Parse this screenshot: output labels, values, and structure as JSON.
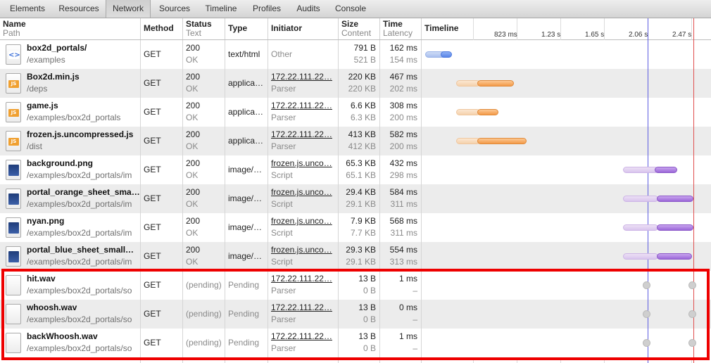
{
  "tabs": [
    "Elements",
    "Resources",
    "Network",
    "Sources",
    "Timeline",
    "Profiles",
    "Audits",
    "Console"
  ],
  "active_tab": "Network",
  "columns": {
    "name": {
      "title": "Name",
      "sub": "Path"
    },
    "method": {
      "title": "Method"
    },
    "status": {
      "title": "Status",
      "sub": "Text"
    },
    "type": {
      "title": "Type"
    },
    "initiator": {
      "title": "Initiator"
    },
    "size": {
      "title": "Size",
      "sub": "Content"
    },
    "time": {
      "title": "Time",
      "sub": "Latency"
    },
    "timeline": {
      "title": "Timeline"
    }
  },
  "timeline_ticks": [
    "823 ms",
    "1.23 s",
    "1.65 s",
    "2.06 s",
    "2.47 s"
  ],
  "highlight_color": "#ee0000",
  "rows": [
    {
      "name": "box2d_portals/",
      "path": "/examples",
      "method": "GET",
      "status": "200",
      "status_text": "OK",
      "type": "text/html",
      "initiator": "Other",
      "initiator_sub": "",
      "initiator_link": false,
      "size": "791 B",
      "content": "521 B",
      "time": "162 ms",
      "latency": "154 ms",
      "icon": "html-icon"
    },
    {
      "name": "Box2d.min.js",
      "path": "/deps",
      "method": "GET",
      "status": "200",
      "status_text": "OK",
      "type": "applica…",
      "initiator": "172.22.111.22…",
      "initiator_sub": "Parser",
      "initiator_link": true,
      "size": "220 KB",
      "content": "220 KB",
      "time": "467 ms",
      "latency": "202 ms",
      "icon": "js-icon"
    },
    {
      "name": "game.js",
      "path": "/examples/box2d_portals",
      "method": "GET",
      "status": "200",
      "status_text": "OK",
      "type": "applica…",
      "initiator": "172.22.111.22…",
      "initiator_sub": "Parser",
      "initiator_link": true,
      "size": "6.6 KB",
      "content": "6.3 KB",
      "time": "308 ms",
      "latency": "200 ms",
      "icon": "js-icon"
    },
    {
      "name": "frozen.js.uncompressed.js",
      "path": "/dist",
      "method": "GET",
      "status": "200",
      "status_text": "OK",
      "type": "applica…",
      "initiator": "172.22.111.22…",
      "initiator_sub": "Parser",
      "initiator_link": true,
      "size": "413 KB",
      "content": "412 KB",
      "time": "582 ms",
      "latency": "200 ms",
      "icon": "js-icon"
    },
    {
      "name": "background.png",
      "path": "/examples/box2d_portals/im",
      "method": "GET",
      "status": "200",
      "status_text": "OK",
      "type": "image/…",
      "initiator": "frozen.js.unco…",
      "initiator_sub": "Script",
      "initiator_link": true,
      "size": "65.3 KB",
      "content": "65.1 KB",
      "time": "432 ms",
      "latency": "298 ms",
      "icon": "image-icon"
    },
    {
      "name": "portal_orange_sheet_sma…",
      "path": "/examples/box2d_portals/im",
      "method": "GET",
      "status": "200",
      "status_text": "OK",
      "type": "image/…",
      "initiator": "frozen.js.unco…",
      "initiator_sub": "Script",
      "initiator_link": true,
      "size": "29.4 KB",
      "content": "29.1 KB",
      "time": "584 ms",
      "latency": "311 ms",
      "icon": "image-icon"
    },
    {
      "name": "nyan.png",
      "path": "/examples/box2d_portals/im",
      "method": "GET",
      "status": "200",
      "status_text": "OK",
      "type": "image/…",
      "initiator": "frozen.js.unco…",
      "initiator_sub": "Script",
      "initiator_link": true,
      "size": "7.9 KB",
      "content": "7.7 KB",
      "time": "568 ms",
      "latency": "311 ms",
      "icon": "image-icon"
    },
    {
      "name": "portal_blue_sheet_small…",
      "path": "/examples/box2d_portals/im",
      "method": "GET",
      "status": "200",
      "status_text": "OK",
      "type": "image/…",
      "initiator": "frozen.js.unco…",
      "initiator_sub": "Script",
      "initiator_link": true,
      "size": "29.3 KB",
      "content": "29.1 KB",
      "time": "554 ms",
      "latency": "313 ms",
      "icon": "image-icon"
    },
    {
      "name": "hit.wav",
      "path": "/examples/box2d_portals/so",
      "method": "GET",
      "status": "(pending)",
      "status_text": "",
      "type": "Pending",
      "initiator": "172.22.111.22…",
      "initiator_sub": "Parser",
      "initiator_link": true,
      "size": "13 B",
      "content": "0 B",
      "time": "1 ms",
      "latency": "–",
      "icon": "file-icon"
    },
    {
      "name": "whoosh.wav",
      "path": "/examples/box2d_portals/so",
      "method": "GET",
      "status": "(pending)",
      "status_text": "",
      "type": "Pending",
      "initiator": "172.22.111.22…",
      "initiator_sub": "Parser",
      "initiator_link": true,
      "size": "13 B",
      "content": "0 B",
      "time": "0 ms",
      "latency": "–",
      "icon": "file-icon"
    },
    {
      "name": "backWhoosh.wav",
      "path": "/examples/box2d_portals/so",
      "method": "GET",
      "status": "(pending)",
      "status_text": "",
      "type": "Pending",
      "initiator": "172.22.111.22…",
      "initiator_sub": "Parser",
      "initiator_link": true,
      "size": "13 B",
      "content": "0 B",
      "time": "1 ms",
      "latency": "–",
      "icon": "file-icon"
    }
  ]
}
